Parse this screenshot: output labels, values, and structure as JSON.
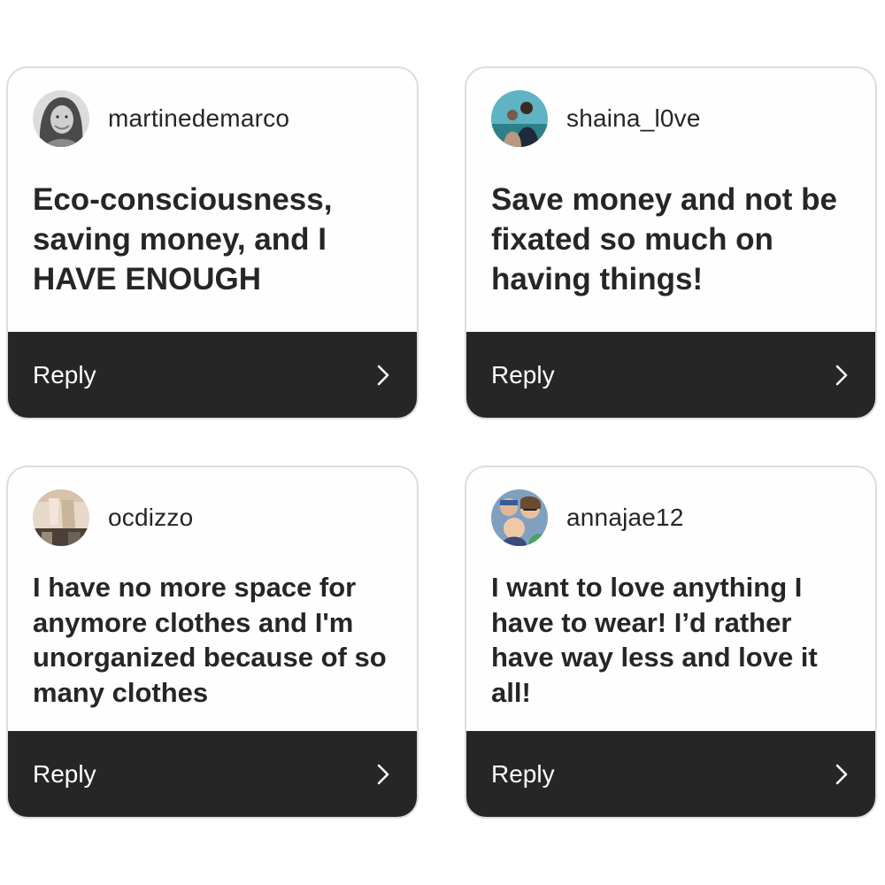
{
  "cards": [
    {
      "username": "martinedemarco",
      "avatar_icon": "woman-portrait-avatar",
      "message": "Eco-consciousness, saving money, and I HAVE ENOUGH",
      "reply_label": "Reply",
      "chevron_icon": "chevron-right-icon"
    },
    {
      "username": "shaina_l0ve",
      "avatar_icon": "couple-photo-avatar",
      "message": "Save money and not be fixated so much on having things!",
      "reply_label": "Reply",
      "chevron_icon": "chevron-right-icon"
    },
    {
      "username": "ocdizzo",
      "avatar_icon": "closet-photo-avatar",
      "message": "I have no more space for anymore clothes and I'm unorganized because of so many clothes",
      "reply_label": "Reply",
      "chevron_icon": "chevron-right-icon"
    },
    {
      "username": "annajae12",
      "avatar_icon": "family-selfie-avatar",
      "message": "I want to love anything I have to wear! I’d rather have way less and love it all!",
      "reply_label": "Reply",
      "chevron_icon": "chevron-right-icon"
    }
  ],
  "colors": {
    "card_background": "#fefefe",
    "card_border": "#dedede",
    "reply_bar": "#262626",
    "text": "#262626",
    "reply_text": "#ffffff"
  }
}
